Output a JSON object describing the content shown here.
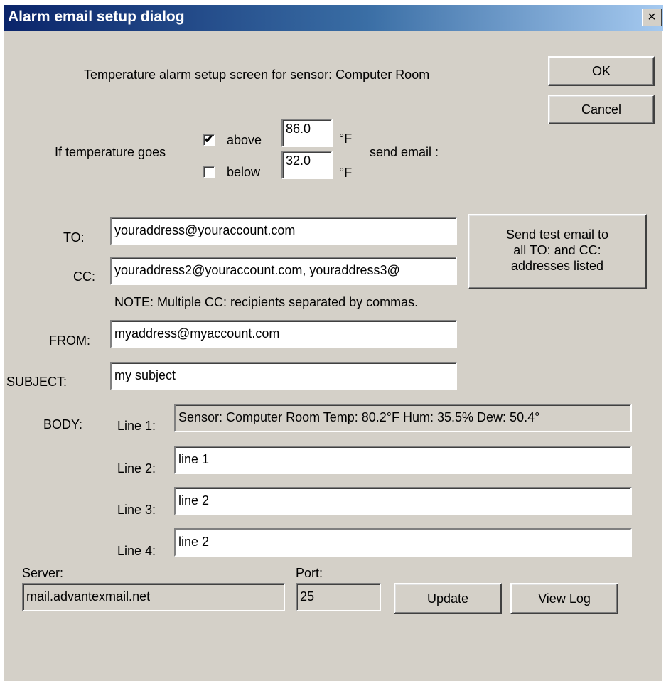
{
  "window": {
    "title": "Alarm email setup dialog",
    "close_glyph": "×"
  },
  "header": {
    "caption": "Temperature alarm setup screen for sensor: Computer Room"
  },
  "buttons": {
    "ok": "OK",
    "cancel": "Cancel",
    "send_test": [
      "Send test email to",
      "all TO: and CC:",
      "addresses listed"
    ],
    "update": "Update",
    "view_log": "View Log"
  },
  "trigger": {
    "label": "If temperature goes",
    "above": {
      "label": "above",
      "checked": true,
      "check_glyph": "✔",
      "value": "86.0",
      "unit": "°F"
    },
    "below": {
      "label": "below",
      "checked": false,
      "value": "32.0",
      "unit": "°F"
    },
    "action": "send email :"
  },
  "fields": {
    "to": {
      "label": "TO:",
      "value": "youraddress@youraccount.com"
    },
    "cc": {
      "label": "CC:",
      "value": "youraddress2@youraccount.com, youraddress3@"
    },
    "note": "NOTE: Multiple CC: recipients separated by commas.",
    "from": {
      "label": "FROM:",
      "value": "myaddress@myaccount.com"
    },
    "subject": {
      "label": "SUBJECT:",
      "value": "my subject"
    }
  },
  "body": {
    "label": "BODY:",
    "lines": [
      {
        "label": "Line 1:",
        "value": "Sensor: Computer Room   Temp: 80.2°F  Hum: 35.5%  Dew: 50.4°"
      },
      {
        "label": "Line 2:",
        "value": "line 1"
      },
      {
        "label": "Line 3:",
        "value": "line 2"
      },
      {
        "label": "Line 4:",
        "value": "line 2"
      }
    ]
  },
  "server": {
    "label": "Server:",
    "value": "mail.advantexmail.net",
    "port_label": "Port:",
    "port_value": "25"
  }
}
